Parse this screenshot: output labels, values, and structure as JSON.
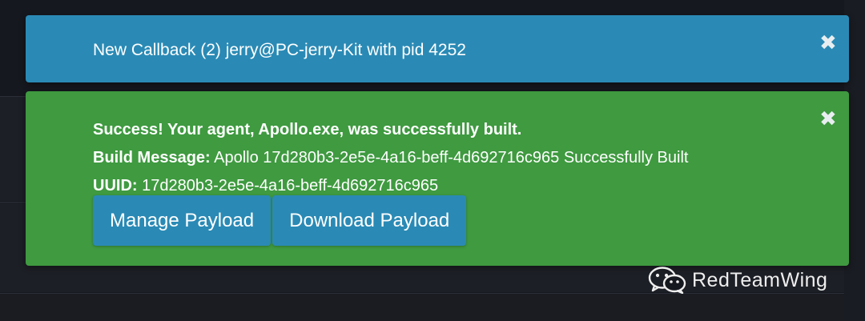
{
  "notifications": {
    "callback": {
      "message": "New Callback (2) jerry@PC-jerry-Kit with pid 4252",
      "close_icon": "close-icon",
      "close_glyph": "✖",
      "color": "#2a8ab5"
    },
    "build_success": {
      "headline": "Success! Your agent, Apollo.exe, was successfully built.",
      "build_message_label": "Build Message:",
      "build_message_value": " Apollo 17d280b3-2e5e-4a16-beff-4d692716c965 Successfully Built",
      "uuid_label": "UUID:",
      "uuid_value": " 17d280b3-2e5e-4a16-beff-4d692716c965",
      "close_icon": "close-icon",
      "close_glyph": "✖",
      "color": "#3f9a40",
      "buttons": {
        "manage": "Manage Payload",
        "download": "Download Payload"
      },
      "button_color": "#2a8ab5"
    }
  },
  "watermark": {
    "icon": "wechat-icon",
    "text": "RedTeamWing"
  }
}
